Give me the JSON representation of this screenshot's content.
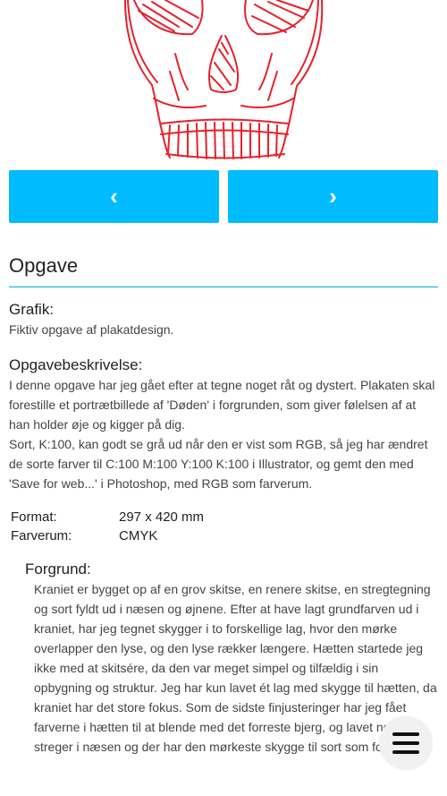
{
  "nav": {
    "prev_label": "‹",
    "next_label": "›",
    "accent_color": "#00bcff"
  },
  "section": {
    "title": "Opgave"
  },
  "grafik": {
    "heading": "Grafik:",
    "text": "Fiktiv opgave af plakatdesign."
  },
  "beskrivelse": {
    "heading": "Opgavebeskrivelse:",
    "text": "I denne opgave har jeg gået efter at tegne noget råt og dystert. Plakaten skal forestille et portrætbillede af 'Døden' i forgrunden, som giver følelsen af at han holder øje og kigger på dig.",
    "text2": "Sort, K:100, kan godt se grå ud når den er vist som RGB, så jeg har ændret de sorte farver til C:100 M:100 Y:100 K:100 i Illustrator, og gemt den med 'Save for web...' i Photoshop, med RGB som farverum."
  },
  "specs": [
    {
      "label": "Format:",
      "value": "297 x 420 mm"
    },
    {
      "label": "Farverum:",
      "value": "CMYK"
    }
  ],
  "forgrund": {
    "heading": "Forgrund:",
    "text": "Kraniet er bygget op af en grov skitse, en renere skitse, en stregtegning og sort fyldt ud i næsen og øjnene. Efter at have lagt grundfarven ud i kraniet, har jeg tegnet skygger i to forskellige lag, hvor den mørke overlapper den lyse, og den lyse rækker længere. Hætten startede jeg ikke med at skitsére, da den var meget simpel og tilfældig i sin opbygning og struktur. Jeg har kun lavet ét lag med skygge til hætten, da kraniet har det store fokus. Som de sidste finjusteringer har jeg fået farverne i hætten til at blende med det forreste bjerg, og lavet nogle streger i næsen og der har den mørkeste skygge til sort som forløb."
  },
  "illustration_color": "#e8202a",
  "menu_icon": "hamburger-icon"
}
